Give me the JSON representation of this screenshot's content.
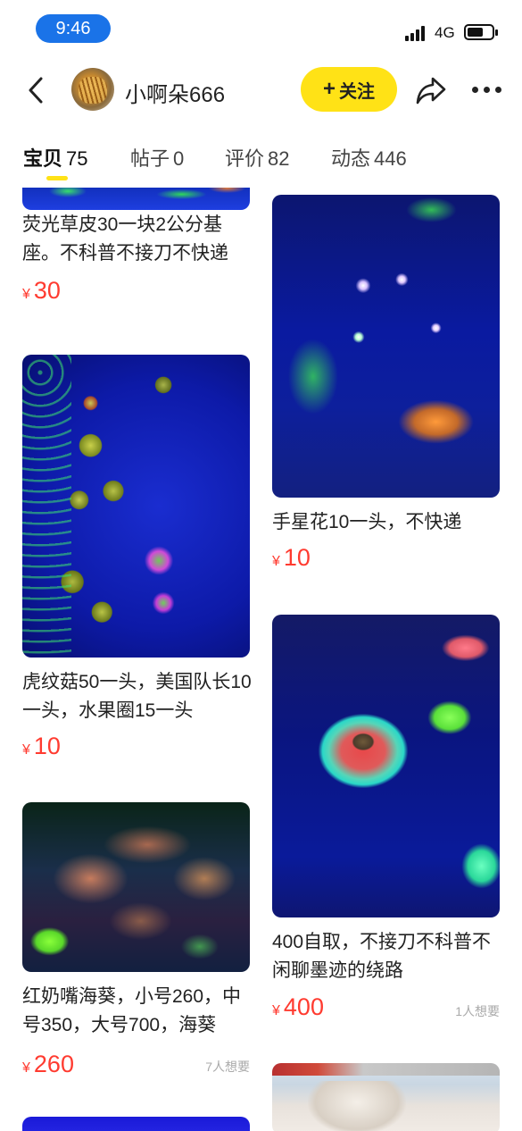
{
  "status_bar": {
    "time": "9:46",
    "network": "4G",
    "colors": {
      "time_pill": "#1a73e8"
    }
  },
  "header": {
    "back_icon": "chevron-left-icon",
    "username": "小啊朵666",
    "follow_button": {
      "icon": "+",
      "label": "关注"
    },
    "share_icon": "share-arrow-icon",
    "more_icon": "ellipsis-icon",
    "colors": {
      "follow_button": "#ffe216"
    }
  },
  "tabs": [
    {
      "label": "宝贝",
      "count": "75",
      "active": true
    },
    {
      "label": "帖子",
      "count": "0",
      "active": false
    },
    {
      "label": "评价",
      "count": "82",
      "active": false
    },
    {
      "label": "动态",
      "count": "446",
      "active": false
    }
  ],
  "currency": "¥",
  "price_color": "#ff3b30",
  "items": [
    {
      "title": "荧光草皮30一块2公分基座。不科普不接刀不快递",
      "price": "30",
      "wants": ""
    },
    {
      "title": "虎纹菇50一头，美国队长10一头，水果圈15一头",
      "price": "10",
      "wants": ""
    },
    {
      "title": "红奶嘴海葵，小号260，中号350，大号700，海葵",
      "price": "260",
      "wants": "7人想要"
    },
    {
      "title": "手星花10一头，不快递",
      "price": "10",
      "wants": ""
    },
    {
      "title": "400自取，不接刀不科普不闲聊墨迹的绕路",
      "price": "400",
      "wants": "1人想要"
    }
  ]
}
